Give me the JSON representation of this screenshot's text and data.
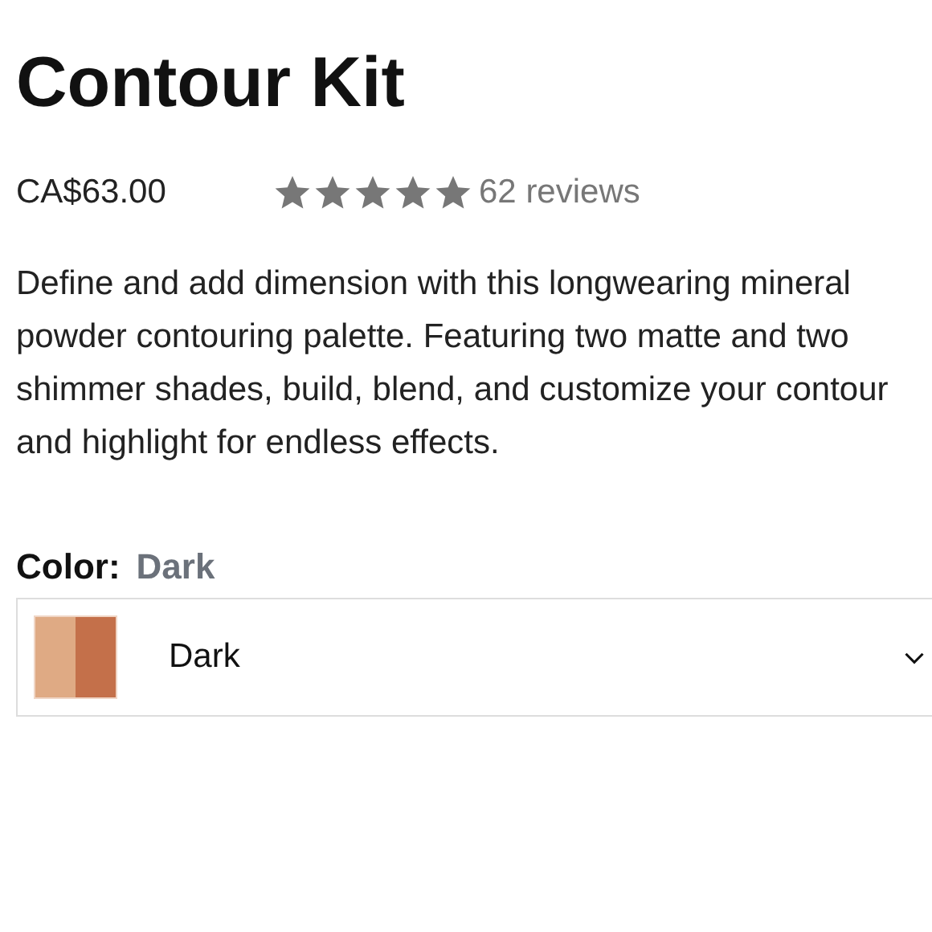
{
  "product": {
    "title": "Contour Kit",
    "price": "CA$63.00",
    "stars": 5,
    "reviews": "62 reviews",
    "description": "Define and add dimension with this longwearing mineral powder contouring palette. Featuring two matte and two shimmer shades, build, blend, and customize your contour and highlight for endless effects."
  },
  "color": {
    "label": "Color:",
    "value": "Dark",
    "dropdown_value": "Dark"
  }
}
